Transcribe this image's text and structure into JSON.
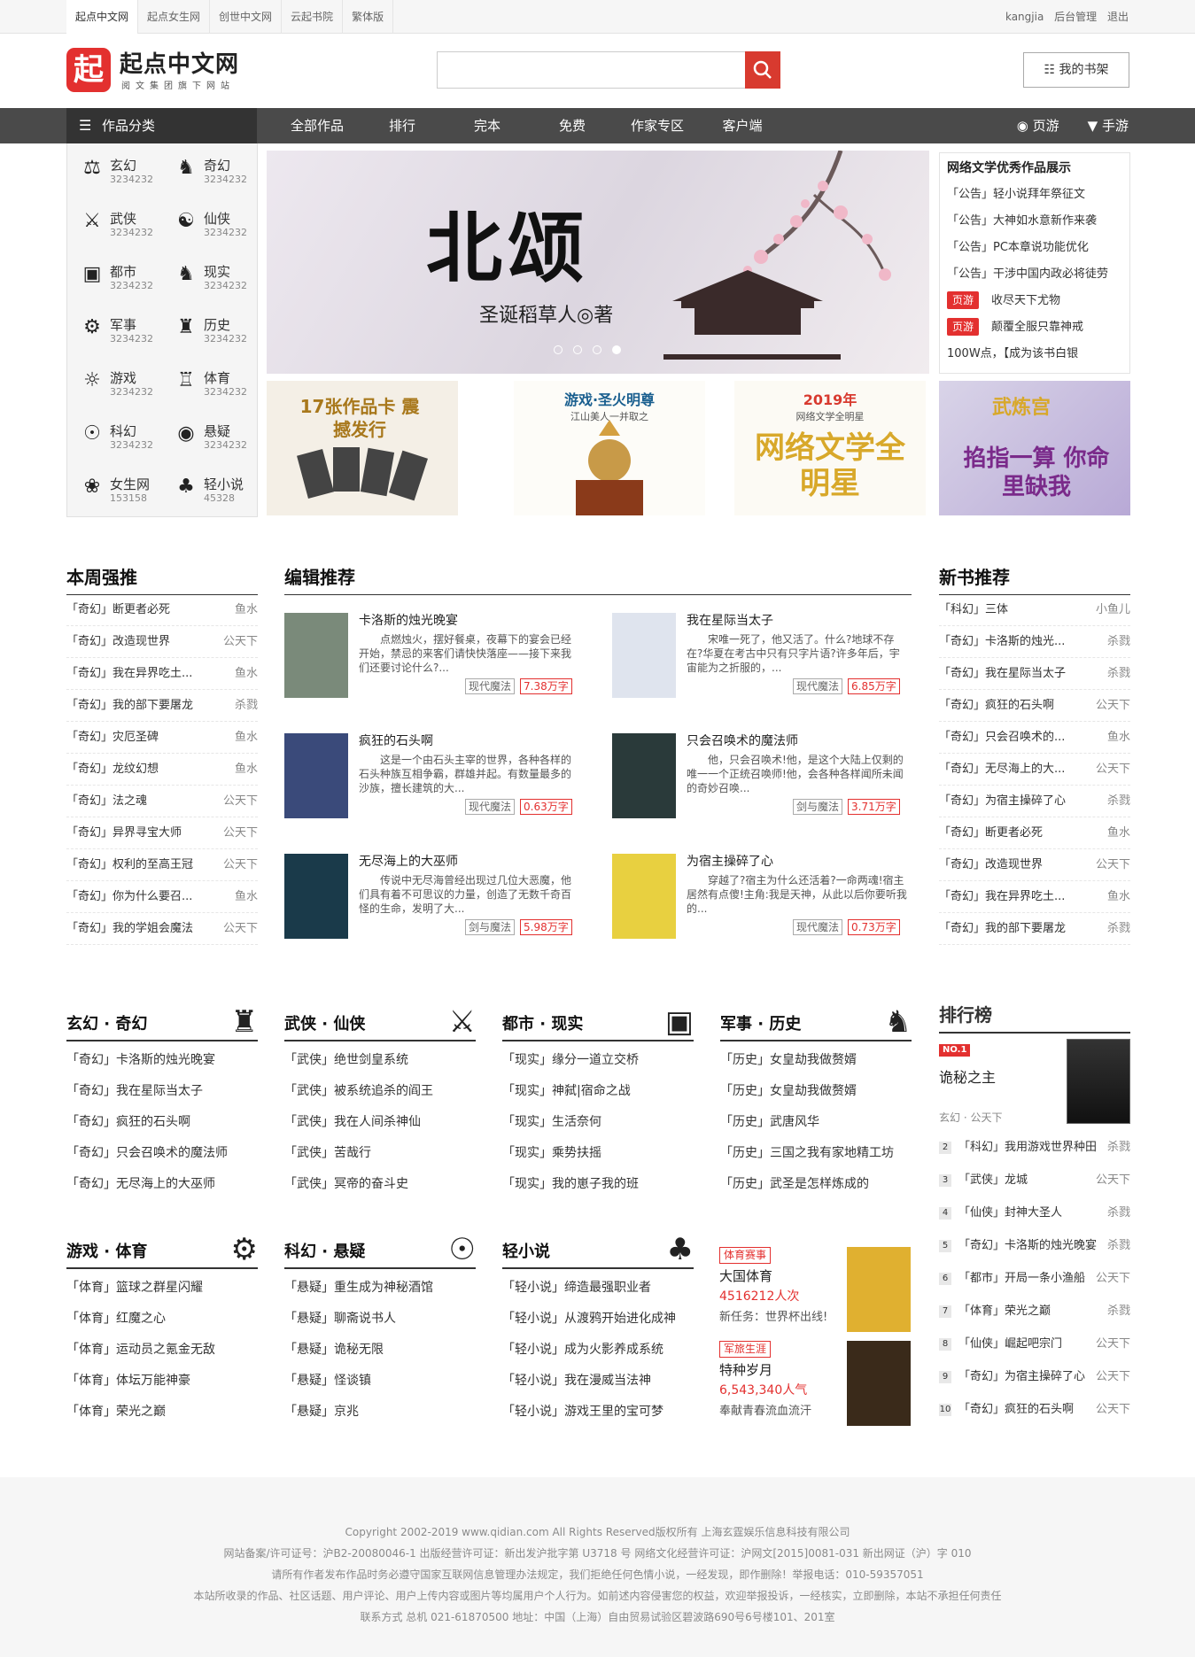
{
  "topbar": {
    "links": [
      "起点中文网",
      "起点女生网",
      "创世中文网",
      "云起书院",
      "繁体版"
    ],
    "user": "kangjia",
    "admin": "后台管理",
    "logout": "退出"
  },
  "logo": {
    "mark": "起",
    "name": "起点中文网",
    "slogan": "阅文集团旗下网站"
  },
  "search": {
    "placeholder": "",
    "icon": "search-icon"
  },
  "shelf": {
    "label": "我的书架",
    "icon": "bookshelf-icon"
  },
  "nav": {
    "category": "作品分类",
    "items": [
      "全部作品",
      "排行",
      "完本",
      "免费",
      "作家专区",
      "客户端"
    ],
    "right": [
      "页游",
      "手游"
    ]
  },
  "categories": [
    {
      "name": "玄幻",
      "count": "3234232",
      "icon": "dragon-icon"
    },
    {
      "name": "奇幻",
      "count": "3234232",
      "icon": "beast-icon"
    },
    {
      "name": "武侠",
      "count": "3234232",
      "icon": "swordsman-icon"
    },
    {
      "name": "仙侠",
      "count": "3234232",
      "icon": "immortal-icon"
    },
    {
      "name": "都市",
      "count": "3234232",
      "icon": "city-icon"
    },
    {
      "name": "现实",
      "count": "3234232",
      "icon": "suit-icon"
    },
    {
      "name": "军事",
      "count": "3234232",
      "icon": "military-icon"
    },
    {
      "name": "历史",
      "count": "3234232",
      "icon": "castle-icon"
    },
    {
      "name": "游戏",
      "count": "3234232",
      "icon": "game-icon"
    },
    {
      "name": "体育",
      "count": "3234232",
      "icon": "trophy-icon"
    },
    {
      "name": "科幻",
      "count": "3234232",
      "icon": "planet-icon"
    },
    {
      "name": "悬疑",
      "count": "3234232",
      "icon": "eye-icon"
    },
    {
      "name": "女生网",
      "count": "153158",
      "icon": "feather-icon"
    },
    {
      "name": "轻小说",
      "count": "45328",
      "icon": "cat-icon"
    }
  ],
  "banner": {
    "title": "北颂",
    "author": "圣诞稻草人◎著"
  },
  "notice": {
    "title": "网络文学优秀作品展示",
    "items": [
      {
        "tag": "",
        "text": "「公告」轻小说拜年祭征文"
      },
      {
        "tag": "",
        "text": "「公告」大神如水意新作来袭"
      },
      {
        "tag": "",
        "text": "「公告」PC本章说功能优化"
      },
      {
        "tag": "",
        "text": "「公告」干涉中国内政必将徒劳"
      },
      {
        "tag": "页游",
        "text": "收尽天下尤物"
      },
      {
        "tag": "页游",
        "text": "颠覆全服只靠神戒"
      },
      {
        "tag": "",
        "text": "100W点，【成为该书白银"
      }
    ]
  },
  "ads": [
    {
      "title": "17张作品卡 震撼发行"
    },
    {
      "title": "游戏·圣火明尊",
      "sub": "江山美人一并取之"
    },
    {
      "title": "2019年",
      "sub": "网络文学全明星",
      "big": "网络文学全明星"
    },
    {
      "title": "武炼宫",
      "sub": "掐指一算 你命里缺我"
    }
  ],
  "weekly": {
    "title": "本周强推",
    "items": [
      {
        "t": "「奇幻」断更者必死",
        "a": "鱼水"
      },
      {
        "t": "「奇幻」改造现世界",
        "a": "公天下"
      },
      {
        "t": "「奇幻」我在异界吃土...",
        "a": "鱼水"
      },
      {
        "t": "「奇幻」我的部下要屠龙",
        "a": "杀戮"
      },
      {
        "t": "「奇幻」灾厄圣碑",
        "a": "鱼水"
      },
      {
        "t": "「奇幻」龙纹幻想",
        "a": "鱼水"
      },
      {
        "t": "「奇幻」法之魂",
        "a": "公天下"
      },
      {
        "t": "「奇幻」异界寻宝大师",
        "a": "公天下"
      },
      {
        "t": "「奇幻」权利的至高王冠",
        "a": "公天下"
      },
      {
        "t": "「奇幻」你为什么要召...",
        "a": "鱼水"
      },
      {
        "t": "「奇幻」我的学姐会魔法",
        "a": "公天下"
      }
    ]
  },
  "editor": {
    "title": "编辑推荐",
    "books": [
      {
        "name": "卡洛斯的烛光晚宴",
        "desc": "点燃烛火，摆好餐桌，夜幕下的宴会已经开始，禁忌的来客们请快快落座——接下来我们还要讨论什么?...",
        "type": "现代魔法",
        "words": "7.38万字"
      },
      {
        "name": "我在星际当太子",
        "desc": "宋唯一死了，他又活了。什么?地球不存在?华夏在考古中只有只字片语?许多年后，宇宙能为之折服的，...",
        "type": "现代魔法",
        "words": "6.85万字"
      },
      {
        "name": "疯狂的石头啊",
        "desc": "这是一个由石头主宰的世界，各种各样的石头种族互相争霸，群雄并起。有数量最多的沙族，擅长建筑的大...",
        "type": "现代魔法",
        "words": "0.63万字"
      },
      {
        "name": "只会召唤术的魔法师",
        "desc": "他，只会召唤术!他，是这个大陆上仅剩的唯一一个正统召唤师!他，会各种各样闻所未闻的奇妙召唤...",
        "type": "剑与魔法",
        "words": "3.71万字"
      },
      {
        "name": "无尽海上的大巫师",
        "desc": "传说中无尽海曾经出现过几位大恶魔，他们具有着不可思议的力量，创造了无数千奇百怪的生命，发明了大...",
        "type": "剑与魔法",
        "words": "5.98万字"
      },
      {
        "name": "为宿主操碎了心",
        "desc": "穿越了?宿主为什么还活着?一命两魂!宿主居然有点傻!主角:我是天神，从此以后你要听我的...",
        "type": "现代魔法",
        "words": "0.73万字"
      }
    ]
  },
  "newbooks": {
    "title": "新书推荐",
    "items": [
      {
        "t": "「科幻」三体",
        "a": "小鱼儿"
      },
      {
        "t": "「奇幻」卡洛斯的烛光...",
        "a": "杀戮"
      },
      {
        "t": "「奇幻」我在星际当太子",
        "a": "杀戮"
      },
      {
        "t": "「奇幻」疯狂的石头啊",
        "a": "公天下"
      },
      {
        "t": "「奇幻」只会召唤术的...",
        "a": "鱼水"
      },
      {
        "t": "「奇幻」无尽海上的大...",
        "a": "公天下"
      },
      {
        "t": "「奇幻」为宿主操碎了心",
        "a": "杀戮"
      },
      {
        "t": "「奇幻」断更者必死",
        "a": "鱼水"
      },
      {
        "t": "「奇幻」改造现世界",
        "a": "公天下"
      },
      {
        "t": "「奇幻」我在异界吃土...",
        "a": "鱼水"
      },
      {
        "t": "「奇幻」我的部下要屠龙",
        "a": "杀戮"
      }
    ]
  },
  "catsec": [
    {
      "title": "玄幻 · 奇幻",
      "items": [
        "「奇幻」卡洛斯的烛光晚宴",
        "「奇幻」我在星际当太子",
        "「奇幻」疯狂的石头啊",
        "「奇幻」只会召唤术的魔法师",
        "「奇幻」无尽海上的大巫师"
      ]
    },
    {
      "title": "武侠 · 仙侠",
      "items": [
        "「武侠」绝世剑皇系统",
        "「武侠」被系统追杀的阎王",
        "「武侠」我在人间杀神仙",
        "「武侠」苦哉行",
        "「武侠」冥帝的奋斗史"
      ]
    },
    {
      "title": "都市 · 现实",
      "items": [
        "「现实」缘分一道立交桥",
        "「现实」神弑|宿命之战",
        "「现实」生活奈何",
        "「现实」乘势扶摇",
        "「现实」我的崽子我的班"
      ]
    },
    {
      "title": "军事 · 历史",
      "items": [
        "「历史」女皇劫我做赘婿",
        "「历史」女皇劫我做赘婿",
        "「历史」武唐风华",
        "「历史」三国之我有家地精工坊",
        "「历史」武圣是怎样炼成的"
      ]
    },
    {
      "title": "游戏 · 体育",
      "items": [
        "「体育」篮球之群星闪耀",
        "「体育」红魔之心",
        "「体育」运动员之氪金无敌",
        "「体育」体坛万能神豪",
        "「体育」荣光之巅"
      ]
    },
    {
      "title": "科幻 · 悬疑",
      "items": [
        "「悬疑」重生成为神秘酒馆",
        "「悬疑」聊斋说书人",
        "「悬疑」诡秘无限",
        "「悬疑」怪谈镇",
        "「悬疑」京兆"
      ]
    },
    {
      "title": "轻小说",
      "items": [
        "「轻小说」缔造最强职业者",
        "「轻小说」从渡鸦开始进化成神",
        "「轻小说」成为火影养成系统",
        "「轻小说」我在漫威当法神",
        "「轻小说」游戏王里的宝可梦"
      ]
    }
  ],
  "minis": [
    {
      "tag": "体育赛事",
      "name": "大国体育",
      "num": "4516212人次",
      "sub": "新任务：世界杯出线!"
    },
    {
      "tag": "军旅生涯",
      "name": "特种岁月",
      "num": "6,543,340人气",
      "sub": "奉献青春流血流汗"
    }
  ],
  "rank": {
    "title": "排行榜",
    "top": {
      "badge": "NO.1",
      "name": "诡秘之主",
      "meta": "玄幻 · 公天下"
    },
    "items": [
      {
        "n": "2",
        "t": "「科幻」我用游戏世界种田",
        "a": "杀戮"
      },
      {
        "n": "3",
        "t": "「武侠」龙城",
        "a": "公天下"
      },
      {
        "n": "4",
        "t": "「仙侠」封神大圣人",
        "a": "杀戮"
      },
      {
        "n": "5",
        "t": "「奇幻」卡洛斯的烛光晚宴",
        "a": "杀戮"
      },
      {
        "n": "6",
        "t": "「都市」开局一条小渔船",
        "a": "公天下"
      },
      {
        "n": "7",
        "t": "「体育」荣光之巅",
        "a": "杀戮"
      },
      {
        "n": "8",
        "t": "「仙侠」崛起吧宗门",
        "a": "公天下"
      },
      {
        "n": "9",
        "t": "「奇幻」为宿主操碎了心",
        "a": "公天下"
      },
      {
        "n": "10",
        "t": "「奇幻」疯狂的石头啊",
        "a": "公天下"
      }
    ]
  },
  "footer": [
    "Copyright   2002-2019 www.qidian.com All Rights Reserved版权所有 上海玄霆娱乐信息科技有限公司",
    "网站备案/许可证号：沪B2-20080046-1 出版经营许可证：新出发沪批字第 U3718 号 网络文化经营许可证：沪网文[2015]0081-031 新出网证（沪）字 010",
    "请所有作者发布作品时务必遵守国家互联网信息管理办法规定，我们拒绝任何色情小说，一经发现，即作删除！举报电话：010-59357051",
    "本站所收录的作品、社区话题、用户评论、用户上传内容或图片等均属用户个人行为。如前述内容侵害您的权益，欢迎举报投诉，一经核实，立即删除，本站不承担任何责任",
    "联系方式 总机 021-61870500 地址：中国（上海）自由贸易试验区碧波路690号6号楼101、201室"
  ]
}
